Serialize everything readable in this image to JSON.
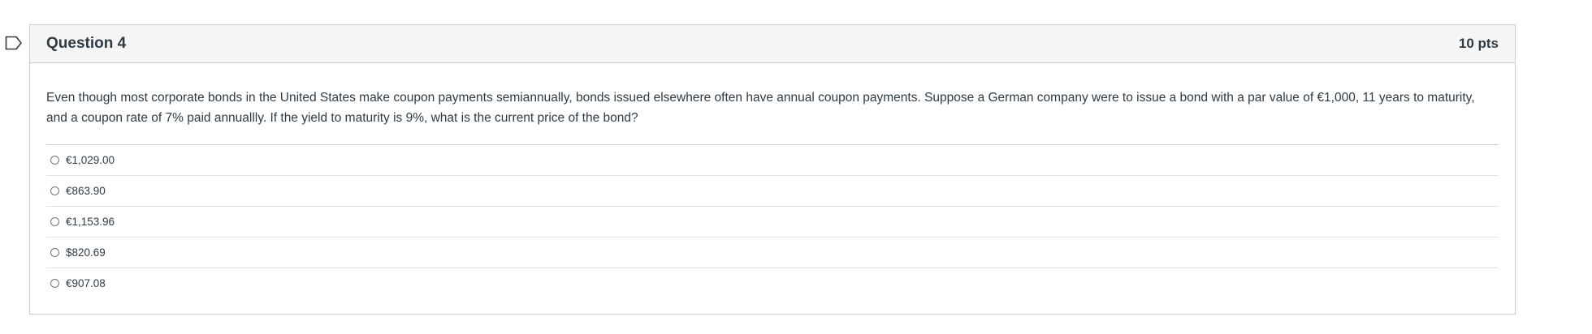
{
  "question": {
    "title": "Question 4",
    "points": "10 pts",
    "text": "Even though most corporate bonds in the United States make coupon payments semiannually, bonds issued elsewhere often have annual coupon payments. Suppose a German company were to issue a bond with a par value of €1,000, 11 years to maturity, and a coupon rate of 7% paid annuallly. If the yield to maturity is 9%, what is the current price of the bond?",
    "answers": [
      {
        "label": "€1,029.00",
        "selected": false
      },
      {
        "label": "€863.90",
        "selected": false
      },
      {
        "label": "€1,153.96",
        "selected": false
      },
      {
        "label": "$820.69",
        "selected": false
      },
      {
        "label": "€907.08",
        "selected": false
      }
    ]
  },
  "icons": {
    "flag": "flag-question-icon"
  },
  "colors": {
    "border": "#c7cdd1",
    "header_bg": "#f5f5f5",
    "text": "#2d3b45"
  }
}
